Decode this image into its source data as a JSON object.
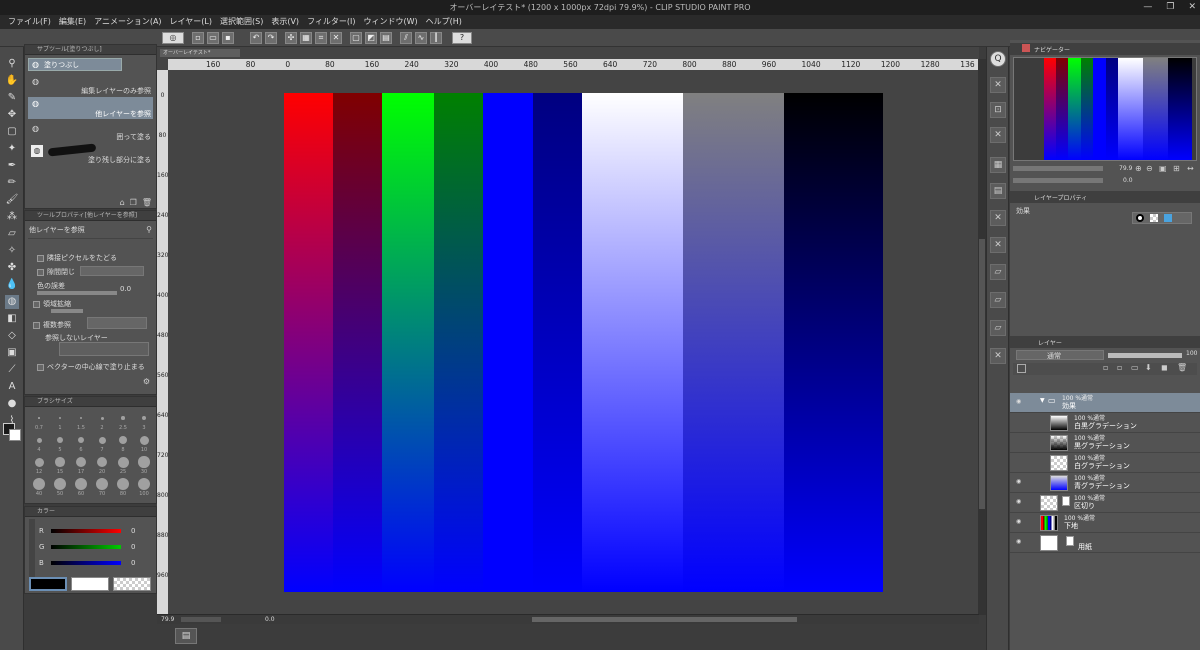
{
  "window": {
    "title": "オーバーレイテスト* (1200 x 1000px 72dpi 79.9%) - CLIP STUDIO PAINT PRO"
  },
  "menu": [
    "ファイル(F)",
    "編集(E)",
    "アニメーション(A)",
    "レイヤー(L)",
    "選択範囲(S)",
    "表示(V)",
    "フィルター(I)",
    "ウィンドウ(W)",
    "ヘルプ(H)"
  ],
  "subtool": {
    "tab": "サブツール[塗りつぶし]",
    "group": "塗りつぶし",
    "items": [
      "編集レイヤーのみ参照",
      "他レイヤーを参照",
      "囲って塗る",
      "塗り残し部分に塗る"
    ],
    "selected_index": 1
  },
  "tool_property": {
    "tab": "ツールプロパティ[他レイヤーを参照]",
    "title": "他レイヤーを参照",
    "follow_adjacent": "隣接ピクセルをたどる",
    "close_gap": "隙間閉じ",
    "color_margin_label": "色の誤差",
    "color_margin_value": "0.0",
    "area_scaling": "領域拡縮",
    "multi_refer": "複数参照",
    "no_refer_layer": "参照しないレイヤー",
    "vector_center": "ベクターの中心線で塗り止まる"
  },
  "brush_size": {
    "tab": "ブラシサイズ",
    "rows": [
      [
        "0.7",
        "1",
        "1.5",
        "2",
        "2.5",
        "3"
      ],
      [
        "4",
        "5",
        "6",
        "7",
        "8",
        "10"
      ],
      [
        "12",
        "15",
        "17",
        "20",
        "25",
        "30"
      ],
      [
        "40",
        "50",
        "60",
        "70",
        "80",
        "100"
      ]
    ]
  },
  "color_panel": {
    "tab": "カラー",
    "channels": [
      {
        "name": "R",
        "value": "0",
        "color": "#ff0000"
      },
      {
        "name": "G",
        "value": "0",
        "color": "#00cc00"
      },
      {
        "name": "B",
        "value": "0",
        "color": "#0000ff"
      }
    ]
  },
  "canvas": {
    "doc_tab": "オーバーレイテスト*",
    "ruler_top": [
      "160",
      "80",
      "0",
      "80",
      "160",
      "240",
      "320",
      "400",
      "480",
      "560",
      "640",
      "720",
      "800",
      "880",
      "960",
      "1040",
      "1120",
      "1200",
      "1280",
      "136"
    ],
    "ruler_left": [
      "0",
      "80",
      "160",
      "240",
      "320",
      "400",
      "480",
      "560",
      "640",
      "720",
      "800",
      "880",
      "960"
    ],
    "stripes": [
      {
        "color": "#ff0000"
      },
      {
        "color": "#800000"
      },
      {
        "color": "#00ff00"
      },
      {
        "color": "#008000"
      },
      {
        "color": "#0000ff"
      },
      {
        "color": "#000080"
      },
      {
        "color": "#ffffff"
      },
      {
        "color": "#808080"
      },
      {
        "color": "#000000"
      }
    ],
    "zoom": "79.9",
    "rotation": "0.0"
  },
  "status": {
    "zoom": "79.9",
    "angle": "0.0"
  },
  "navigator": {
    "tab": "ナビゲーター",
    "zoom": "79.9",
    "angle": "0.0"
  },
  "layer_property": {
    "tab": "レイヤープロパティ",
    "effect_label": "効果"
  },
  "layers_panel": {
    "tab": "レイヤー",
    "blend": "通常",
    "opacity": "100",
    "layers": [
      {
        "mode": "100 %通常",
        "name": "効果",
        "folder": true
      },
      {
        "mode": "100 %通常",
        "name": "白黒グラデーション"
      },
      {
        "mode": "100 %通常",
        "name": "黒グラデーション"
      },
      {
        "mode": "100 %通常",
        "name": "白グラデーション"
      },
      {
        "mode": "100 %通常",
        "name": "青グラデーション"
      },
      {
        "mode": "100 %通常",
        "name": "区切り"
      },
      {
        "mode": "100 %通常",
        "name": "下地"
      },
      {
        "mode": "",
        "name": "用紙"
      }
    ]
  }
}
